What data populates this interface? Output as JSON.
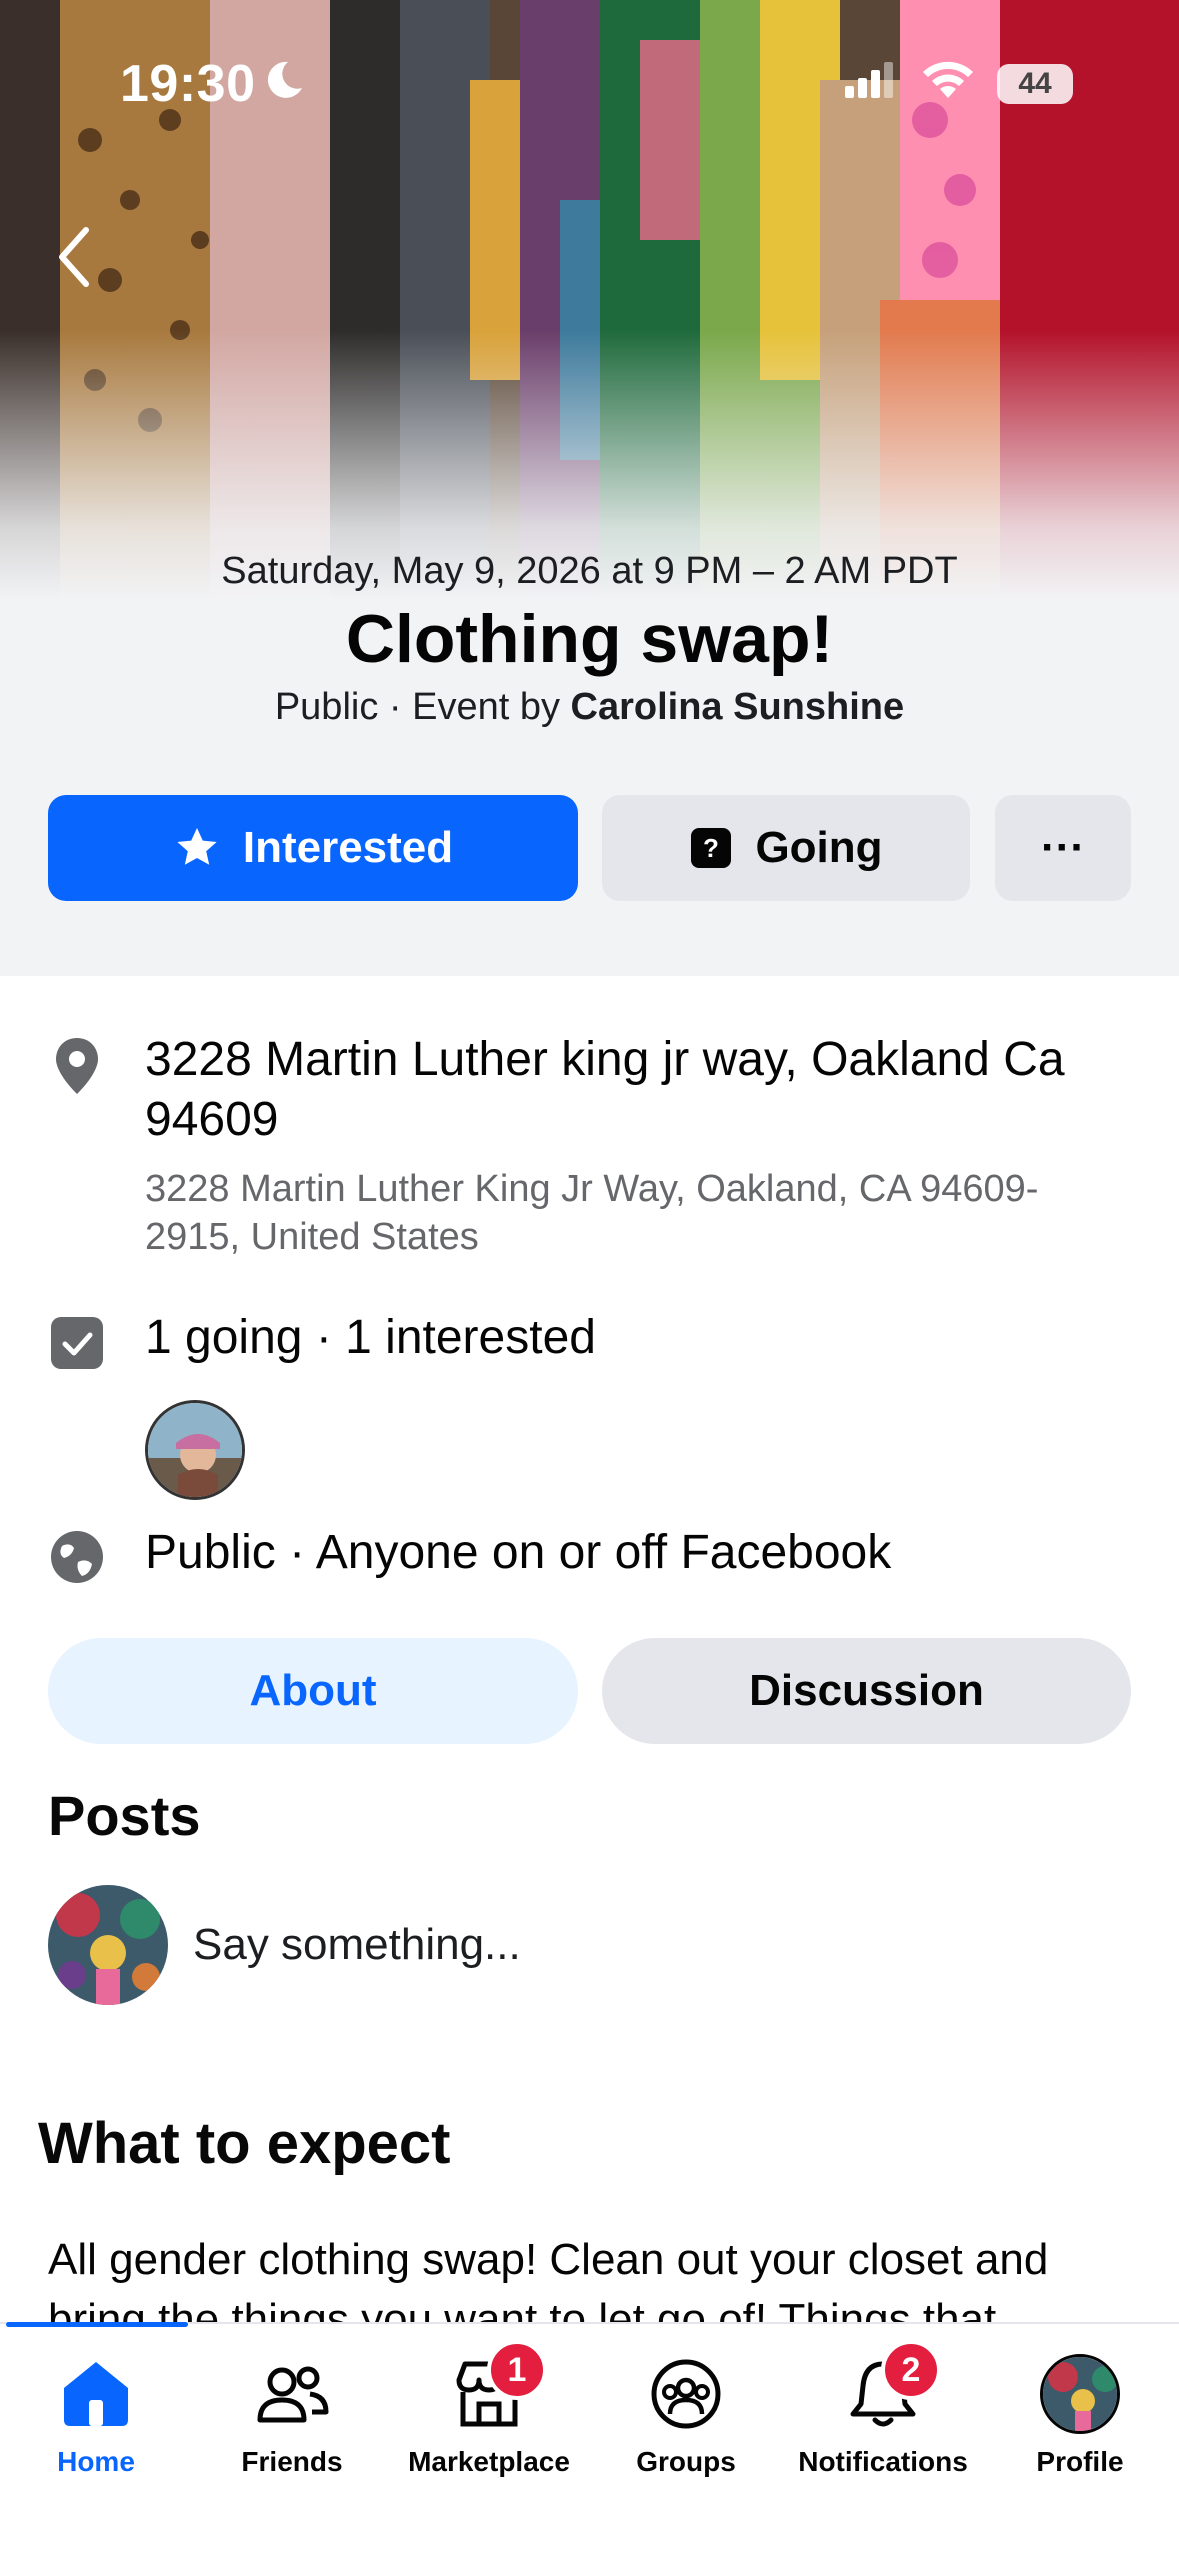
{
  "status_bar": {
    "time": "19:30",
    "battery": "44"
  },
  "event": {
    "date": "Saturday, May 9, 2026 at 9 PM – 2 AM PDT",
    "title": "Clothing swap!",
    "privacy": "Public",
    "by_prefix": "· Event by",
    "host": "Carolina Sunshine"
  },
  "actions": {
    "interested": "Interested",
    "going": "Going",
    "more": "···"
  },
  "details": {
    "address_main": "3228 Martin Luther king jr way, Oakland Ca 94609",
    "address_full": "3228 Martin Luther King Jr Way, Oakland, CA 94609-2915, United States",
    "attendance": "1 going · 1 interested",
    "visibility": "Public · Anyone on or off Facebook"
  },
  "tabs": {
    "about": "About",
    "discussion": "Discussion"
  },
  "posts": {
    "heading": "Posts",
    "composer_placeholder": "Say something..."
  },
  "expect": {
    "heading": "What to expect",
    "text": "All gender clothing swap! Clean out your closet and bring the things you want to let go of! Things that"
  },
  "nav": {
    "items": [
      {
        "label": "Home",
        "icon": "home-icon",
        "active": true
      },
      {
        "label": "Friends",
        "icon": "friends-icon"
      },
      {
        "label": "Marketplace",
        "icon": "marketplace-icon",
        "badge": "1"
      },
      {
        "label": "Groups",
        "icon": "groups-icon"
      },
      {
        "label": "Notifications",
        "icon": "bell-icon",
        "badge": "2"
      },
      {
        "label": "Profile",
        "icon": "profile-avatar"
      }
    ]
  },
  "colors": {
    "accent": "#0866ff",
    "badge": "#e41e3f",
    "background": "#f2f3f5"
  }
}
